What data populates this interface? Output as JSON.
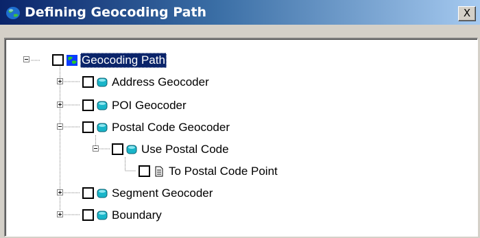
{
  "window": {
    "title": "Defining Geocoding Path",
    "close_label": "X",
    "title_icon": "globe-icon"
  },
  "tree": {
    "root": {
      "label": "Geocoding Path",
      "icon": "globe-icon",
      "expanded": true,
      "checked": false,
      "selected": true
    },
    "items": [
      {
        "label": "Address Geocoder",
        "icon": "geocoder-icon",
        "expanded": false,
        "checked": false
      },
      {
        "label": "POI Geocoder",
        "icon": "geocoder-icon",
        "expanded": false,
        "checked": false
      },
      {
        "label": "Postal Code Geocoder",
        "icon": "geocoder-icon",
        "expanded": true,
        "checked": false
      },
      {
        "label": "Use Postal Code",
        "icon": "geocoder-icon",
        "expanded": true,
        "checked": false
      },
      {
        "label": "To Postal Code Point",
        "icon": "document-icon",
        "checked": false
      },
      {
        "label": "Segment Geocoder",
        "icon": "geocoder-icon",
        "expanded": false,
        "checked": false
      },
      {
        "label": "Boundary",
        "icon": "geocoder-icon",
        "expanded": false,
        "checked": false
      }
    ]
  },
  "colors": {
    "titlebar_start": "#0a246a",
    "titlebar_end": "#a6caf0",
    "selection": "#0a246a",
    "window_face": "#d4d0c8"
  }
}
